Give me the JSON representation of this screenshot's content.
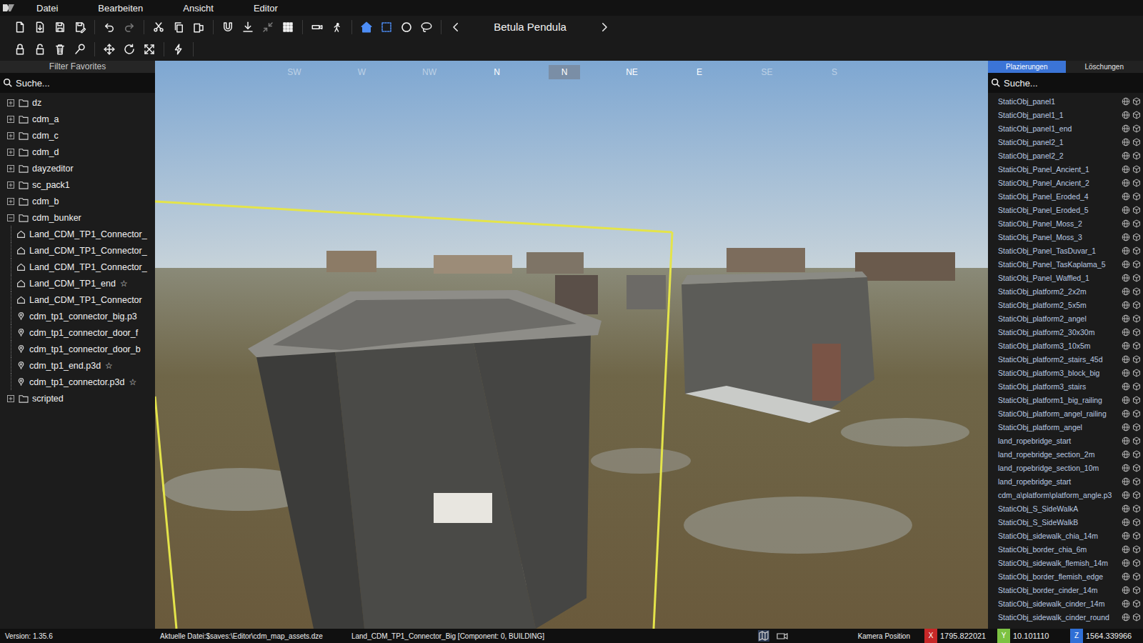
{
  "menu": [
    "Datei",
    "Bearbeiten",
    "Ansicht",
    "Editor"
  ],
  "toolbar": {
    "row1": [
      {
        "kind": "new",
        "active": false,
        "disabled": false
      },
      {
        "kind": "import",
        "active": false,
        "disabled": false
      },
      {
        "kind": "save",
        "active": false,
        "disabled": false
      },
      {
        "kind": "saveas",
        "active": false,
        "disabled": false
      },
      {
        "kind": "separator",
        "active": false,
        "disabled": false
      },
      {
        "kind": "undo",
        "active": false,
        "disabled": false
      },
      {
        "kind": "redo",
        "active": false,
        "disabled": true
      },
      {
        "kind": "separator",
        "active": false,
        "disabled": false
      },
      {
        "kind": "cut",
        "active": false,
        "disabled": false
      },
      {
        "kind": "copy",
        "active": false,
        "disabled": false
      },
      {
        "kind": "paste",
        "active": false,
        "disabled": false
      },
      {
        "kind": "separator",
        "active": false,
        "disabled": false
      },
      {
        "kind": "magnet",
        "active": false,
        "disabled": false
      },
      {
        "kind": "ground",
        "active": false,
        "disabled": false
      },
      {
        "kind": "collapse",
        "active": false,
        "disabled": true
      },
      {
        "kind": "grid",
        "active": false,
        "disabled": false
      },
      {
        "kind": "separator",
        "active": false,
        "disabled": false
      },
      {
        "kind": "camera",
        "active": false,
        "disabled": false
      },
      {
        "kind": "walk",
        "active": false,
        "disabled": false
      },
      {
        "kind": "separator",
        "active": false,
        "disabled": false
      },
      {
        "kind": "house",
        "active": true,
        "disabled": false
      },
      {
        "kind": "rect",
        "active": true,
        "disabled": false
      },
      {
        "kind": "circle",
        "active": false,
        "disabled": false
      },
      {
        "kind": "lasso",
        "active": false,
        "disabled": false
      },
      {
        "kind": "separator",
        "active": false,
        "disabled": false
      }
    ],
    "selector": {
      "label": "Betula Pendula"
    },
    "row2": [
      {
        "kind": "lock",
        "active": false,
        "disabled": false
      },
      {
        "kind": "unlock",
        "active": false,
        "disabled": false
      },
      {
        "kind": "trash",
        "active": false,
        "disabled": false
      },
      {
        "kind": "search",
        "active": false,
        "disabled": false
      },
      {
        "kind": "separator",
        "active": false,
        "disabled": false
      },
      {
        "kind": "move",
        "active": false,
        "disabled": false
      },
      {
        "kind": "rotate",
        "active": false,
        "disabled": false
      },
      {
        "kind": "scale",
        "active": false,
        "disabled": false
      },
      {
        "kind": "separator",
        "active": false,
        "disabled": false
      },
      {
        "kind": "bolt",
        "active": false,
        "disabled": false
      },
      {
        "kind": "separator",
        "active": false,
        "disabled": false
      }
    ]
  },
  "tree": {
    "header": "Filter Favorites",
    "search": "Suche...",
    "favorite_mark": "☆",
    "items": [
      {
        "label": "dz",
        "expanded": false,
        "children": []
      },
      {
        "label": "cdm_a",
        "expanded": false,
        "children": []
      },
      {
        "label": "cdm_c",
        "expanded": false,
        "children": []
      },
      {
        "label": "cdm_d",
        "expanded": false,
        "children": []
      },
      {
        "label": "dayzeditor",
        "expanded": false,
        "children": []
      },
      {
        "label": "sc_pack1",
        "expanded": false,
        "children": []
      },
      {
        "label": "cdm_b",
        "expanded": false,
        "children": []
      },
      {
        "label": "cdm_bunker",
        "expanded": true,
        "children": [
          {
            "label": "Land_CDM_TP1_Connector_",
            "kind": "object",
            "favorite": false
          },
          {
            "label": "Land_CDM_TP1_Connector_",
            "kind": "object",
            "favorite": false
          },
          {
            "label": "Land_CDM_TP1_Connector_",
            "kind": "object",
            "favorite": false
          },
          {
            "label": "Land_CDM_TP1_end",
            "kind": "object",
            "favorite": true
          },
          {
            "label": "Land_CDM_TP1_Connector",
            "kind": "object",
            "favorite": false
          },
          {
            "label": "cdm_tp1_connector_big.p3",
            "kind": "model",
            "favorite": false
          },
          {
            "label": "cdm_tp1_connector_door_f",
            "kind": "model",
            "favorite": false
          },
          {
            "label": "cdm_tp1_connector_door_b",
            "kind": "model",
            "favorite": false
          },
          {
            "label": "cdm_tp1_end.p3d",
            "kind": "model",
            "favorite": true
          },
          {
            "label": "cdm_tp1_connector.p3d",
            "kind": "model",
            "favorite": true
          }
        ]
      },
      {
        "label": "scripted",
        "expanded": false,
        "children": []
      }
    ]
  },
  "compass": [
    {
      "label": "SW",
      "dim": true,
      "selected": false
    },
    {
      "label": "W",
      "dim": true,
      "selected": false
    },
    {
      "label": "NW",
      "dim": true,
      "selected": false
    },
    {
      "label": "N",
      "dim": false,
      "selected": false
    },
    {
      "label": "N",
      "dim": false,
      "selected": true
    },
    {
      "label": "NE",
      "dim": false,
      "selected": false
    },
    {
      "label": "E",
      "dim": false,
      "selected": false
    },
    {
      "label": "SE",
      "dim": true,
      "selected": false
    },
    {
      "label": "S",
      "dim": true,
      "selected": false
    }
  ],
  "right_panel": {
    "tabs": [
      {
        "label": "Plazierungen",
        "selected": true
      },
      {
        "label": "Löschungen",
        "selected": false
      }
    ],
    "search": "Suche...",
    "items": [
      "StaticObj_panel1",
      "StaticObj_panel1_1",
      "StaticObj_panel1_end",
      "StaticObj_panel2_1",
      "StaticObj_panel2_2",
      "StaticObj_Panel_Ancient_1",
      "StaticObj_Panel_Ancient_2",
      "StaticObj_Panel_Eroded_4",
      "StaticObj_Panel_Eroded_5",
      "StaticObj_Panel_Moss_2",
      "StaticObj_Panel_Moss_3",
      "StaticObj_Panel_TasDuvar_1",
      "StaticObj_Panel_TasKaplama_5",
      "StaticObj_Panel_Waffled_1",
      "StaticObj_platform2_2x2m",
      "StaticObj_platform2_5x5m",
      "StaticObj_platform2_angel",
      "StaticObj_platform2_30x30m",
      "StaticObj_platform3_10x5m",
      "StaticObj_platform2_stairs_45d",
      "StaticObj_platform3_block_big",
      "StaticObj_platform3_stairs",
      "StaticObj_platform1_big_railing",
      "StaticObj_platform_angel_railing",
      "StaticObj_platform_angel",
      "land_ropebridge_start",
      "land_ropebridge_section_2m",
      "land_ropebridge_section_10m",
      "land_ropebridge_start",
      "cdm_a\\platform\\platform_angle.p3",
      "StaticObj_S_SideWalkA",
      "StaticObj_S_SideWalkB",
      "StaticObj_sidewalk_chia_14m",
      "StaticObj_border_chia_6m",
      "StaticObj_sidewalk_flemish_14m",
      "StaticObj_border_flemish_edge",
      "StaticObj_border_cinder_14m",
      "StaticObj_sidewalk_cinder_14m",
      "StaticObj_sidewalk_cinder_round"
    ]
  },
  "status_bar": {
    "version": "Version:  1.35.6",
    "file": "Aktuelle Datei:$saves:\\Editor\\cdm_map_assets.dze",
    "selection": "Land_CDM_TP1_Connector_Big [Component: 0, BUILDING]",
    "camera_label": "Kamera Position",
    "coords": [
      {
        "axis": "X",
        "value": "1795.822021",
        "color": "#c62828"
      },
      {
        "axis": "Y",
        "value": "10.101110",
        "color": "#7cc242"
      },
      {
        "axis": "Z",
        "value": "1564.339966",
        "color": "#2f6fd6"
      }
    ]
  }
}
